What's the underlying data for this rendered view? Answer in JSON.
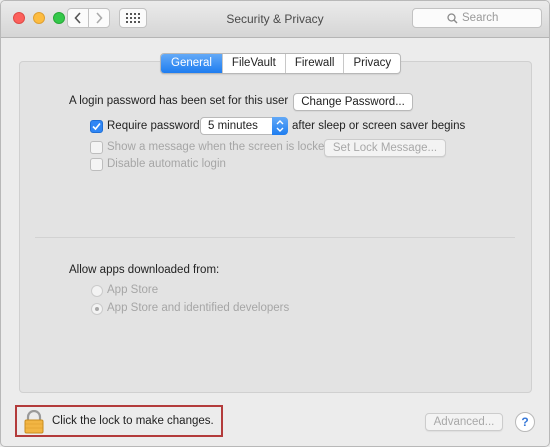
{
  "window": {
    "title": "Security & Privacy",
    "search_placeholder": "Search"
  },
  "tabs": [
    {
      "label": "General",
      "active": true
    },
    {
      "label": "FileVault",
      "active": false
    },
    {
      "label": "Firewall",
      "active": false
    },
    {
      "label": "Privacy",
      "active": false
    }
  ],
  "general": {
    "login_password_text": "A login password has been set for this user",
    "change_password_button": "Change Password...",
    "require_password": {
      "label": "Require password",
      "checked": true,
      "selected_option": "5 minutes",
      "suffix": "after sleep or screen saver begins"
    },
    "show_message": {
      "label": "Show a message when the screen is locked",
      "checked": false,
      "enabled": false,
      "button": "Set Lock Message..."
    },
    "disable_auto_login": {
      "label": "Disable automatic login",
      "checked": false,
      "enabled": false
    }
  },
  "allow_apps": {
    "label": "Allow apps downloaded from:",
    "options": [
      {
        "label": "App Store",
        "selected": false
      },
      {
        "label": "App Store and identified developers",
        "selected": true
      }
    ]
  },
  "footer": {
    "lock_text": "Click the lock to make changes.",
    "advanced_button": "Advanced...",
    "help_button": "?"
  },
  "colors": {
    "accent": "#1e7df0",
    "highlight_border": "#b33b3b",
    "lock_body": "#f2b543"
  }
}
